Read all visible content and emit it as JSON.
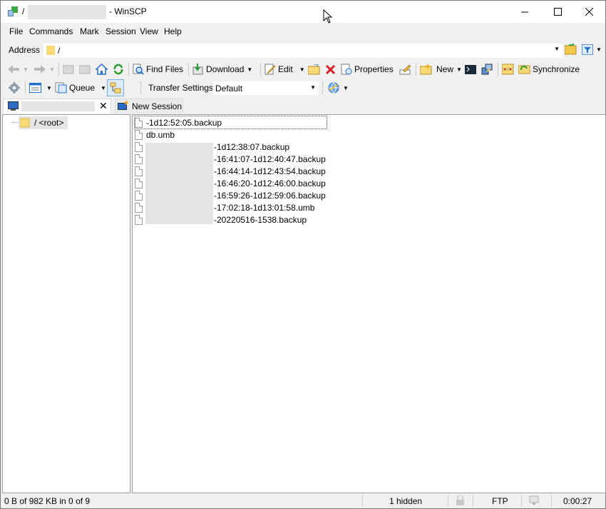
{
  "window": {
    "title_path": "/",
    "title_app": "- WinSCP"
  },
  "menu": [
    "File",
    "Commands",
    "Mark",
    "Session",
    "View",
    "Help"
  ],
  "address": {
    "label": "Address",
    "value": "/"
  },
  "toolbar1": {
    "find_files": "Find Files",
    "download": "Download",
    "edit": "Edit",
    "properties": "Properties",
    "new": "New",
    "synchronize": "Synchronize"
  },
  "toolbar2": {
    "queue": "Queue",
    "transfer_settings_label": "Transfer Settings",
    "transfer_settings_value": "Default"
  },
  "tabs": {
    "new_session": "New Session"
  },
  "tree": {
    "root": "/ <root>"
  },
  "files": [
    "-1d12:52:05.backup",
    "db.umb",
    "-1d12:38:07.backup",
    "-16:41:07-1d12:40:47.backup",
    "-16:44:14-1d12:43:54.backup",
    "-16:46:20-1d12:46:00.backup",
    "-16:59:26-1d12:59:06.backup",
    "-17:02:18-1d13:01:58.umb",
    "-20220516-1538.backup"
  ],
  "status": {
    "selection": "0 B of 982 KB in 0 of 9",
    "hidden": "1 hidden",
    "protocol": "FTP",
    "elapsed": "0:00:27"
  },
  "colors": {
    "folder": "#f9d975",
    "accent_blue": "#1e6fd0",
    "delete_red": "#d42020",
    "refresh_green": "#2e9a32"
  }
}
